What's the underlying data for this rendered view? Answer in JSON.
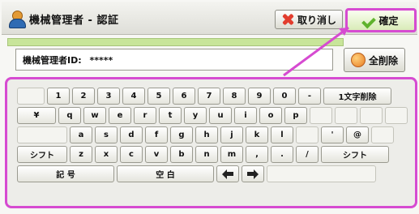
{
  "header": {
    "title": "機械管理者 - 認証",
    "cancel_label": "取り消し",
    "confirm_label": "確定"
  },
  "input": {
    "label": "機械管理者ID:",
    "value": "*****"
  },
  "clear_all_label": "全削除",
  "keyboard": {
    "row1": [
      "",
      "1",
      "2",
      "3",
      "4",
      "5",
      "6",
      "7",
      "8",
      "9",
      "0",
      "-",
      "1文字削除"
    ],
    "row2": [
      "¥",
      "q",
      "w",
      "e",
      "r",
      "t",
      "y",
      "u",
      "i",
      "o",
      "p",
      "",
      "",
      "",
      ""
    ],
    "row3": [
      "",
      "a",
      "s",
      "d",
      "f",
      "g",
      "h",
      "j",
      "k",
      "l",
      "",
      "'",
      "@",
      ""
    ],
    "row4": [
      "シフト",
      "z",
      "x",
      "c",
      "v",
      "b",
      "n",
      "m",
      ",",
      ".",
      "/",
      "シフト"
    ],
    "row5": [
      "記 号",
      "空 白"
    ]
  },
  "icons": {
    "user": "user-icon",
    "cancel": "x-icon",
    "confirm": "check-icon",
    "clear": "eraser-icon"
  },
  "colors": {
    "highlight": "#d64bd1",
    "confirm_bg": "#d9ebb8",
    "cancel_x": "#e23d2e",
    "green_bar": "#c8e59a"
  }
}
